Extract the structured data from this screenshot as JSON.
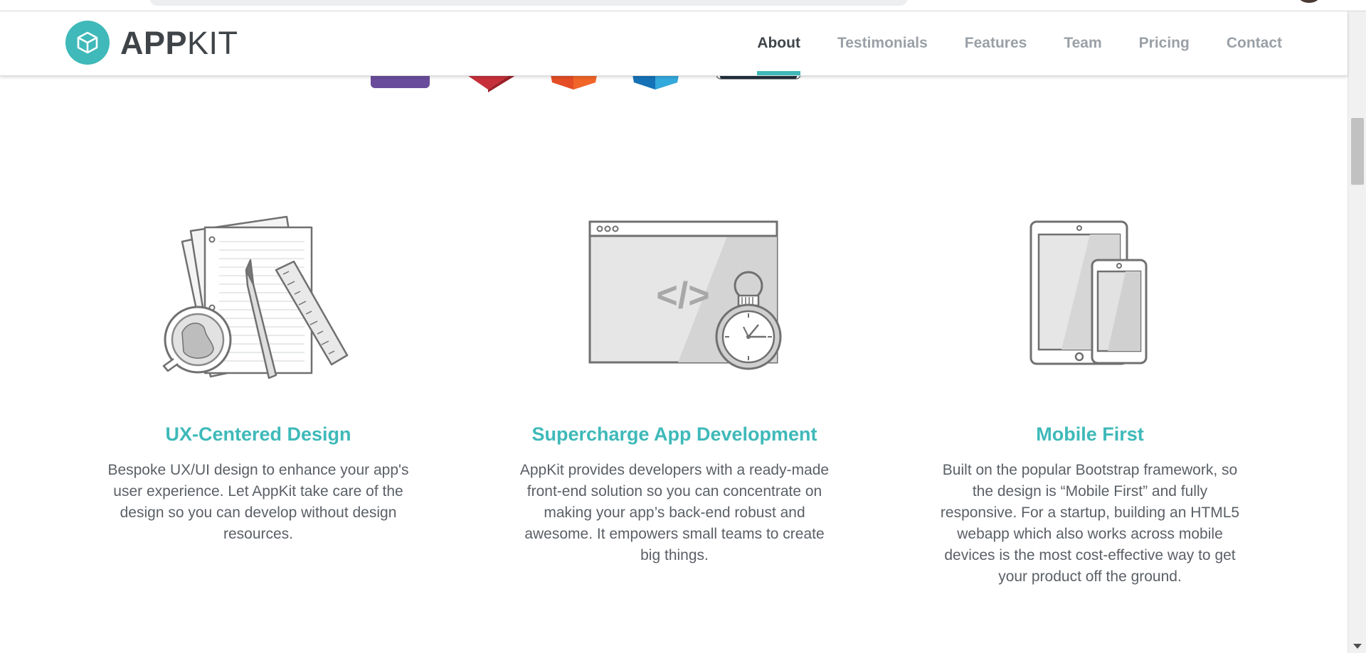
{
  "brand": {
    "name_bold": "APP",
    "name_light": "KIT",
    "logo_icon": "cube-icon",
    "accent_color": "#3fb9b9"
  },
  "nav": {
    "items": [
      {
        "label": "About",
        "active": true
      },
      {
        "label": "Testimonials",
        "active": false
      },
      {
        "label": "Features",
        "active": false
      },
      {
        "label": "Team",
        "active": false
      },
      {
        "label": "Pricing",
        "active": false
      },
      {
        "label": "Contact",
        "active": false
      }
    ]
  },
  "logo_strip": {
    "icons": [
      "purple-logo-icon",
      "red-logo-icon",
      "html5-logo-icon",
      "css3-logo-icon",
      "dark-logo-icon"
    ],
    "colors": [
      "#6a4c9c",
      "#c7303a",
      "#e44d26",
      "#1572b6",
      "#22313f"
    ]
  },
  "features": [
    {
      "icon": "papers-magnifier-ruler-icon",
      "title": "UX-Centered Design",
      "description": "Bespoke UX/UI design to enhance your app's user experience. Let AppKit take care of the design so you can develop without design resources."
    },
    {
      "icon": "browser-code-stopwatch-icon",
      "title": "Supercharge App Development",
      "description": "AppKit provides developers with a ready-made front-end solution so you can concentrate on making your app’s back-end robust and awesome. It empowers small teams to create big things.",
      "code_glyph": "</>"
    },
    {
      "icon": "tablet-phone-icon",
      "title": "Mobile First",
      "description": "Built on the popular Bootstrap framework, so the design is “Mobile First” and fully responsive. For a startup, building an HTML5 webapp which also works across mobile devices is the most cost-effective way to get your product off the ground."
    }
  ]
}
